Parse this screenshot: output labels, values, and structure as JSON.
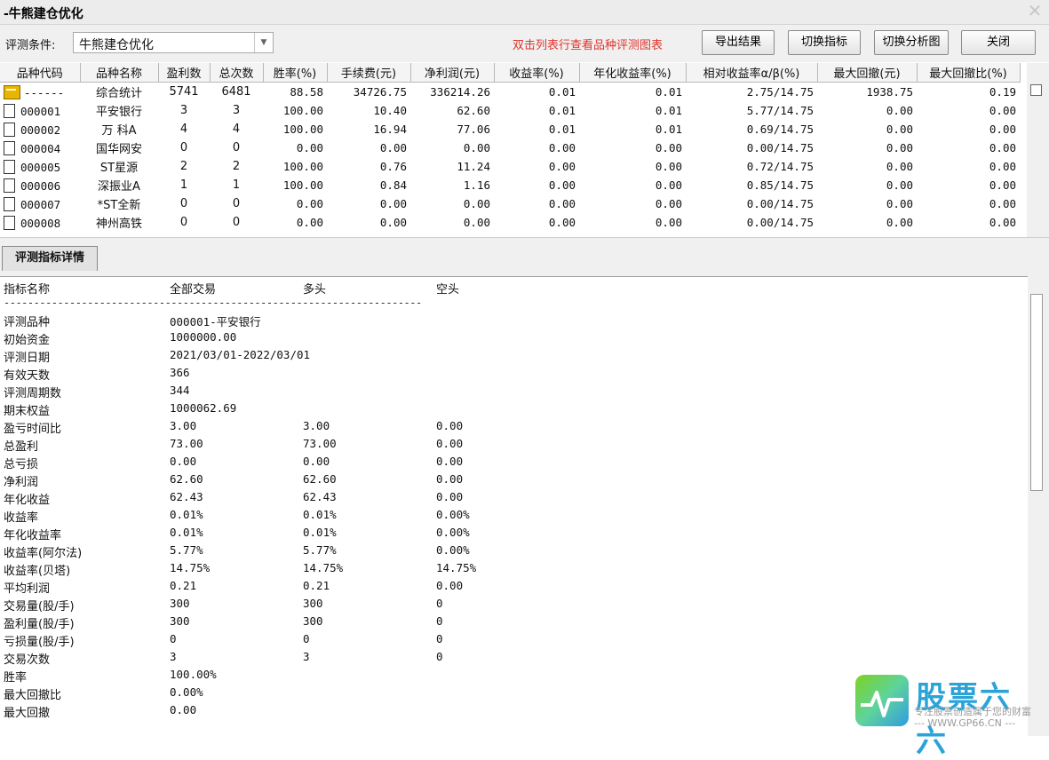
{
  "window": {
    "title": "-牛熊建仓优化"
  },
  "toolbar": {
    "condition_label": "评测条件:",
    "condition_value": "牛熊建仓优化",
    "hint": "双击列表行查看品种评测图表",
    "export_label": "导出结果",
    "switch_metric_label": "切换指标",
    "switch_chart_label": "切换分析图",
    "close_label": "关闭"
  },
  "grid": {
    "columns": [
      "品种代码",
      "品种名称",
      "盈利数",
      "总次数",
      "胜率(%)",
      "手续费(元)",
      "净利润(元)",
      "收益率(%)",
      "年化收益率(%)",
      "相对收益率α/β(%)",
      "最大回撤(元)",
      "最大回撤比(%)"
    ],
    "rows": [
      [
        "------",
        "综合统计",
        "5741",
        "6481",
        "88.58",
        "34726.75",
        "336214.26",
        "0.01",
        "0.01",
        "2.75/14.75",
        "1938.75",
        "0.19"
      ],
      [
        "000001",
        "平安银行",
        "3",
        "3",
        "100.00",
        "10.40",
        "62.60",
        "0.01",
        "0.01",
        "5.77/14.75",
        "0.00",
        "0.00"
      ],
      [
        "000002",
        "万 科A",
        "4",
        "4",
        "100.00",
        "16.94",
        "77.06",
        "0.01",
        "0.01",
        "0.69/14.75",
        "0.00",
        "0.00"
      ],
      [
        "000004",
        "国华网安",
        "0",
        "0",
        "0.00",
        "0.00",
        "0.00",
        "0.00",
        "0.00",
        "0.00/14.75",
        "0.00",
        "0.00"
      ],
      [
        "000005",
        "ST星源",
        "2",
        "2",
        "100.00",
        "0.76",
        "11.24",
        "0.00",
        "0.00",
        "0.72/14.75",
        "0.00",
        "0.00"
      ],
      [
        "000006",
        "深振业A",
        "1",
        "1",
        "100.00",
        "0.84",
        "1.16",
        "0.00",
        "0.00",
        "0.85/14.75",
        "0.00",
        "0.00"
      ],
      [
        "000007",
        "*ST全新",
        "0",
        "0",
        "0.00",
        "0.00",
        "0.00",
        "0.00",
        "0.00",
        "0.00/14.75",
        "0.00",
        "0.00"
      ],
      [
        "000008",
        "神州高铁",
        "0",
        "0",
        "0.00",
        "0.00",
        "0.00",
        "0.00",
        "0.00",
        "0.00/14.75",
        "0.00",
        "0.00"
      ]
    ]
  },
  "detail": {
    "tab_label": "评测指标详情",
    "headers": [
      "指标名称",
      "全部交易",
      "多头",
      "空头"
    ],
    "dash": "----------------------------------------------------------------------",
    "rows": [
      [
        "评测品种",
        "000001-平安银行",
        "",
        ""
      ],
      [
        "初始资金",
        "1000000.00",
        "",
        ""
      ],
      [
        "评测日期",
        "2021/03/01-2022/03/01",
        "",
        ""
      ],
      [
        "有效天数",
        "366",
        "",
        ""
      ],
      [
        "评测周期数",
        "344",
        "",
        ""
      ],
      [
        "期末权益",
        "1000062.69",
        "",
        ""
      ],
      [
        "盈亏时间比",
        "3.00",
        "3.00",
        "0.00"
      ],
      [
        "总盈利",
        "73.00",
        "73.00",
        "0.00"
      ],
      [
        "总亏损",
        "0.00",
        "0.00",
        "0.00"
      ],
      [
        "净利润",
        "62.60",
        "62.60",
        "0.00"
      ],
      [
        "年化收益",
        "62.43",
        "62.43",
        "0.00"
      ],
      [
        "收益率",
        "0.01%",
        "0.01%",
        "0.00%"
      ],
      [
        "年化收益率",
        "0.01%",
        "0.01%",
        "0.00%"
      ],
      [
        "收益率(阿尔法)",
        "5.77%",
        "5.77%",
        "0.00%"
      ],
      [
        "收益率(贝塔)",
        "14.75%",
        "14.75%",
        "14.75%"
      ],
      [
        "平均利润",
        "0.21",
        "0.21",
        "0.00"
      ],
      [
        "交易量(股/手)",
        "300",
        "300",
        "0"
      ],
      [
        "盈利量(股/手)",
        "300",
        "300",
        "0"
      ],
      [
        "亏损量(股/手)",
        "0",
        "0",
        "0"
      ],
      [
        "交易次数",
        "3",
        "3",
        "0"
      ],
      [
        "胜率",
        "100.00%",
        "",
        ""
      ],
      [
        "最大回撤比",
        "0.00%",
        "",
        ""
      ],
      [
        "最大回撤",
        "0.00",
        "",
        ""
      ]
    ]
  },
  "watermark": {
    "brand": "股票六六",
    "slogan": "专注股票创造属于您的财富",
    "url": "--- WWW.GP66.CN ---"
  }
}
